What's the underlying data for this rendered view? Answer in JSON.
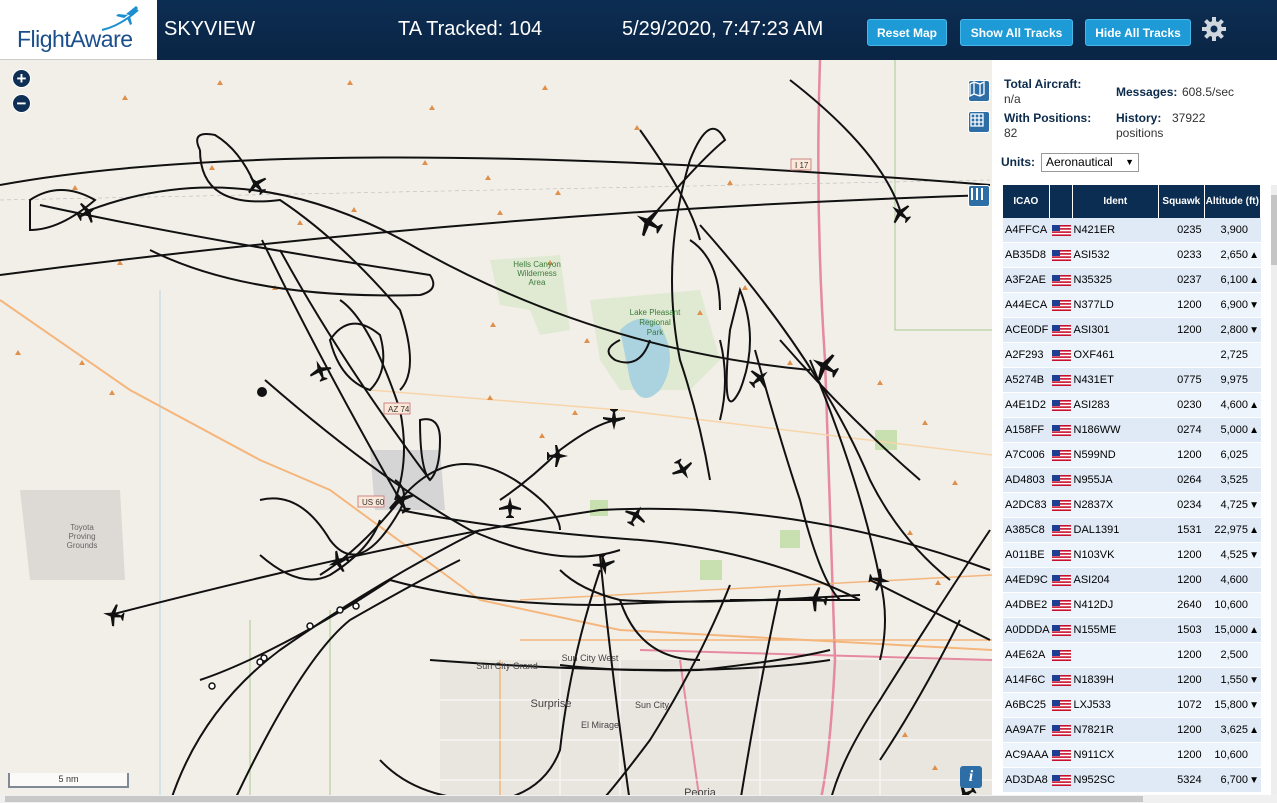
{
  "header": {
    "logo_text": "FlightAware",
    "title": "SKYVIEW",
    "tracked": "TA Tracked: 104",
    "datetime": "5/29/2020, 7:47:23 AM",
    "reset_label": "Reset Map",
    "show_all_label": "Show All Tracks",
    "hide_all_label": "Hide All Tracks"
  },
  "map": {
    "zoom_in": "+",
    "zoom_out": "−",
    "scale_label": "5 nm",
    "info_label": "i",
    "labels": {
      "hells_canyon": "Hells Canyon",
      "wilderness": "Wilderness",
      "area": "Area",
      "lake_pleasant": "Lake Pleasant",
      "regional": "Regional",
      "park": "Park",
      "toyota": "Toyota",
      "proving": "Proving",
      "grounds": "Grounds",
      "sun_city_grand": "Sun City Grand",
      "sun_city_west": "Sun City West",
      "surprise": "Surprise",
      "el_mirage": "El Mirage",
      "sun_city": "Sun City",
      "peoria": "Peoria",
      "us60": "US 60",
      "az74": "AZ 74",
      "i17": "I 17"
    }
  },
  "stats": {
    "total_label": "Total Aircraft:",
    "total_value": "n/a",
    "messages_label": "Messages:",
    "messages_value": "608.5/sec",
    "positions_label": "With Positions:",
    "positions_value": "82",
    "history_label": "History:",
    "history_value": "37922",
    "history_unit": "positions",
    "units_label": "Units:",
    "units_value": "Aeronautical"
  },
  "table": {
    "headers": [
      "ICAO",
      "",
      "Ident",
      "Squawk",
      "Altitude (ft)"
    ],
    "rows": [
      {
        "icao": "A4FFCA",
        "ident": "N421ER",
        "squawk": "0235",
        "alt": "3,900",
        "trend": ""
      },
      {
        "icao": "AB35D8",
        "ident": "ASI532",
        "squawk": "0233",
        "alt": "2,650",
        "trend": "▲"
      },
      {
        "icao": "A3F2AE",
        "ident": "N35325",
        "squawk": "0237",
        "alt": "6,100",
        "trend": "▲"
      },
      {
        "icao": "A44ECA",
        "ident": "N377LD",
        "squawk": "1200",
        "alt": "6,900",
        "trend": "▼"
      },
      {
        "icao": "ACE0DF",
        "ident": "ASI301",
        "squawk": "1200",
        "alt": "2,800",
        "trend": "▼"
      },
      {
        "icao": "A2F293",
        "ident": "OXF461",
        "squawk": "",
        "alt": "2,725",
        "trend": ""
      },
      {
        "icao": "A5274B",
        "ident": "N431ET",
        "squawk": "0775",
        "alt": "9,975",
        "trend": ""
      },
      {
        "icao": "A4E1D2",
        "ident": "ASI283",
        "squawk": "0230",
        "alt": "4,600",
        "trend": "▲"
      },
      {
        "icao": "A158FF",
        "ident": "N186WW",
        "squawk": "0274",
        "alt": "5,000",
        "trend": "▲"
      },
      {
        "icao": "A7C006",
        "ident": "N599ND",
        "squawk": "1200",
        "alt": "6,025",
        "trend": ""
      },
      {
        "icao": "AD4803",
        "ident": "N955JA",
        "squawk": "0264",
        "alt": "3,525",
        "trend": ""
      },
      {
        "icao": "A2DC83",
        "ident": "N2837X",
        "squawk": "0234",
        "alt": "4,725",
        "trend": "▼"
      },
      {
        "icao": "A385C8",
        "ident": "DAL1391",
        "squawk": "1531",
        "alt": "22,975",
        "trend": "▲"
      },
      {
        "icao": "A011BE",
        "ident": "N103VK",
        "squawk": "1200",
        "alt": "4,525",
        "trend": "▼"
      },
      {
        "icao": "A4ED9C",
        "ident": "ASI204",
        "squawk": "1200",
        "alt": "4,600",
        "trend": ""
      },
      {
        "icao": "A4DBE2",
        "ident": "N412DJ",
        "squawk": "2640",
        "alt": "10,600",
        "trend": ""
      },
      {
        "icao": "A0DDDA",
        "ident": "N155ME",
        "squawk": "1503",
        "alt": "15,000",
        "trend": "▲"
      },
      {
        "icao": "A4E62A",
        "ident": "",
        "squawk": "1200",
        "alt": "2,500",
        "trend": ""
      },
      {
        "icao": "A14F6C",
        "ident": "N1839H",
        "squawk": "1200",
        "alt": "1,550",
        "trend": "▼"
      },
      {
        "icao": "A6BC25",
        "ident": "LXJ533",
        "squawk": "1072",
        "alt": "15,800",
        "trend": "▼"
      },
      {
        "icao": "AA9A7F",
        "ident": "N7821R",
        "squawk": "1200",
        "alt": "3,625",
        "trend": "▲"
      },
      {
        "icao": "AC9AAA",
        "ident": "N911CX",
        "squawk": "1200",
        "alt": "10,600",
        "trend": ""
      },
      {
        "icao": "AD3DA8",
        "ident": "N952SC",
        "squawk": "5324",
        "alt": "6,700",
        "trend": "▼"
      }
    ]
  },
  "colors": {
    "header_bg": "#0c2d52",
    "button_bg": "#1e9bd7",
    "map_bg": "#f2efe9",
    "row_bg": "#dfeaf6"
  }
}
